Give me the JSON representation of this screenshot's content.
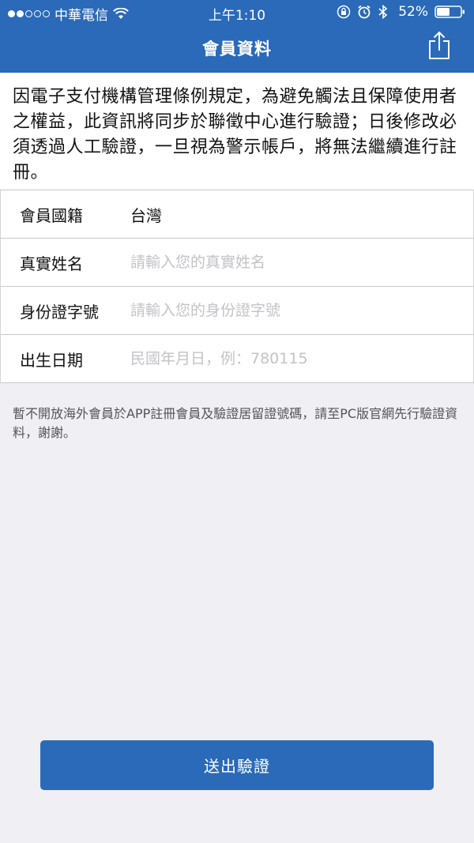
{
  "status_bar": {
    "carrier": "中華電信",
    "time": "上午1:10",
    "battery": "52%",
    "signal_bars_filled": 2,
    "signal_bars_total": 5,
    "icons": [
      "wifi-icon",
      "rotation-lock-icon",
      "alarm-icon",
      "bluetooth-icon",
      "battery-icon"
    ]
  },
  "nav": {
    "title": "會員資料",
    "share_icon": "share-icon"
  },
  "notice": {
    "text": "因電子支付機構管理條例規定，為避免觸法且保障使用者之權益，此資訊將同步於聯徵中心進行驗證；日後修改必須透過人工驗證，一旦視為警示帳戶，將無法繼續進行註冊。"
  },
  "form": {
    "nationality": {
      "label": "會員國籍",
      "value": "台灣"
    },
    "real_name": {
      "label": "真實姓名",
      "placeholder": "請輸入您的真實姓名",
      "value": ""
    },
    "id_number": {
      "label": "身份證字號",
      "placeholder": "請輸入您的身份證字號",
      "value": ""
    },
    "birth_date": {
      "label": "出生日期",
      "placeholder": "民國年月日，例：780115",
      "value": ""
    }
  },
  "footnote": {
    "text": "暫不開放海外會員於APP註冊會員及驗證居留證號碼，請至PC版官網先行驗證資料，謝謝。"
  },
  "submit": {
    "label": "送出驗證"
  },
  "colors": {
    "brand_blue": "#2a6ab8",
    "background": "#efeff4",
    "placeholder": "#c3c3c8"
  }
}
